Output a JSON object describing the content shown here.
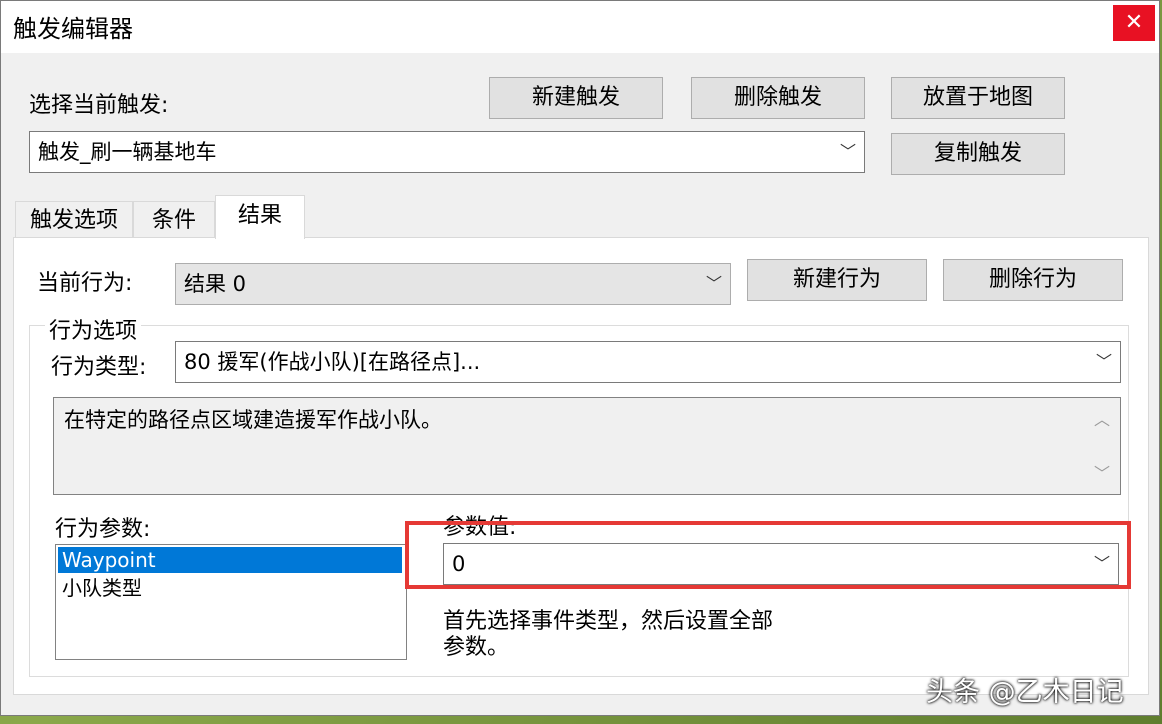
{
  "window": {
    "title": "触发编辑器",
    "close": "✕"
  },
  "header": {
    "select_trigger_label": "选择当前触发:",
    "new_trigger": "新建触发",
    "delete_trigger": "删除触发",
    "place_on_map": "放置于地图",
    "copy_trigger": "复制触发",
    "current_trigger_value": "触发_刷一辆基地车"
  },
  "tabs": [
    {
      "label": "触发选项",
      "active": false
    },
    {
      "label": "条件",
      "active": false
    },
    {
      "label": "结果",
      "active": true
    }
  ],
  "result": {
    "current_action_label": "当前行为:",
    "current_action_value": "结果 0",
    "new_action": "新建行为",
    "delete_action": "删除行为",
    "action_options_group": "行为选项",
    "action_type_label": "行为类型:",
    "action_type_value": "80 援军(作战小队)[在路径点]...",
    "description": "在特定的路径点区域建造援军作战小队。",
    "action_params_label": "行为参数:",
    "params": [
      "Waypoint",
      "小队类型"
    ],
    "selected_param_index": 0,
    "param_value_label": "参数值:",
    "param_value": "0",
    "hint_line1": "首先选择事件类型，然后设置全部",
    "hint_line2": "参数。"
  },
  "watermark": "头条 @乙木日记",
  "icons": {
    "chevron": "chevron-down-icon",
    "scroll_up": "scroll-up-icon",
    "scroll_down": "scroll-down-icon"
  },
  "colors": {
    "close_bg": "#e81123",
    "selection": "#0078d7",
    "highlight_box": "#e53935"
  }
}
